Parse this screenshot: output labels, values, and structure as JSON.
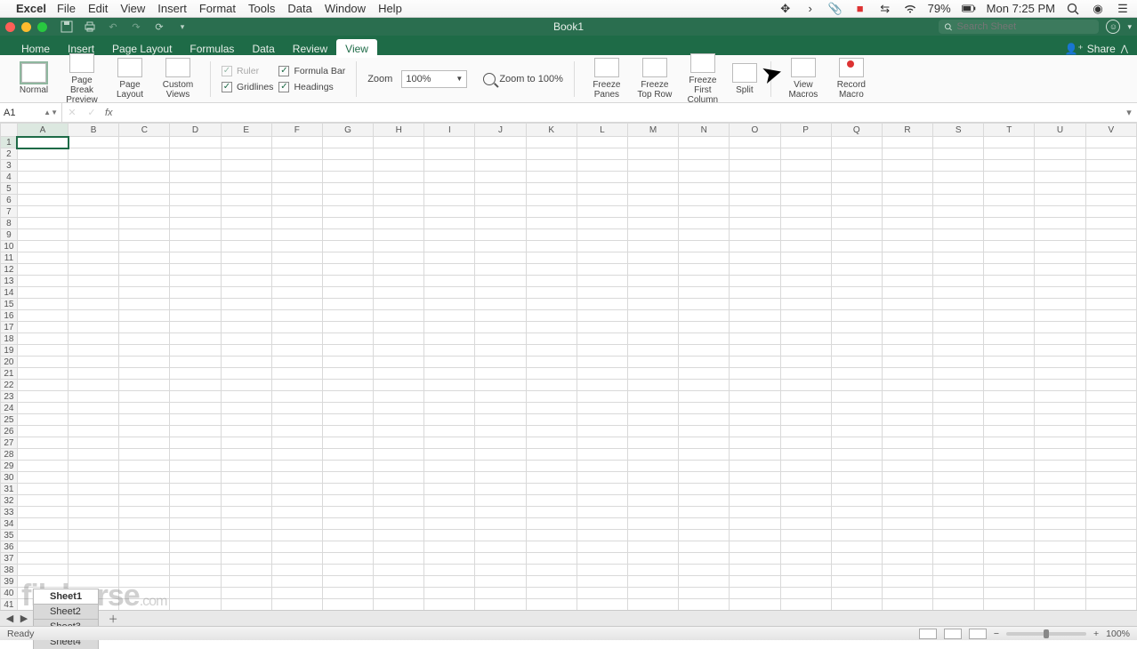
{
  "mac_menu": {
    "app": "Excel",
    "items": [
      "File",
      "Edit",
      "View",
      "Insert",
      "Format",
      "Tools",
      "Data",
      "Window",
      "Help"
    ],
    "battery": "79%",
    "clock": "Mon 7:25 PM"
  },
  "titlebar": {
    "doc_title": "Book1",
    "search_placeholder": "Search Sheet"
  },
  "ribbon_tabs": [
    "Home",
    "Insert",
    "Page Layout",
    "Formulas",
    "Data",
    "Review",
    "View"
  ],
  "ribbon_active": "View",
  "share_label": "Share",
  "view_ribbon": {
    "normal": "Normal",
    "page_break1": "Page Break",
    "page_break2": "Preview",
    "page_layout1": "Page",
    "page_layout2": "Layout",
    "custom1": "Custom",
    "custom2": "Views",
    "ruler": "Ruler",
    "formula_bar": "Formula Bar",
    "gridlines": "Gridlines",
    "headings": "Headings",
    "zoom_label": "Zoom",
    "zoom_value": "100%",
    "zoom_100": "Zoom to 100%",
    "freeze_panes1": "Freeze",
    "freeze_panes2": "Panes",
    "freeze_top1": "Freeze",
    "freeze_top2": "Top Row",
    "freeze_first1": "Freeze First",
    "freeze_first2": "Column",
    "split": "Split",
    "view_macros1": "View",
    "view_macros2": "Macros",
    "record1": "Record",
    "record2": "Macro"
  },
  "namebox": "A1",
  "columns": [
    "A",
    "B",
    "C",
    "D",
    "E",
    "F",
    "G",
    "H",
    "I",
    "J",
    "K",
    "L",
    "M",
    "N",
    "O",
    "P",
    "Q",
    "R",
    "S",
    "T",
    "U",
    "V"
  ],
  "row_count": 41,
  "sheet_tabs": [
    "Sheet1",
    "Sheet2",
    "Sheet3",
    "Sheet4"
  ],
  "sheet_active": "Sheet1",
  "status_text": "Ready",
  "status_zoom": "100%",
  "watermark": "filehorse",
  "watermark_suffix": ".com"
}
